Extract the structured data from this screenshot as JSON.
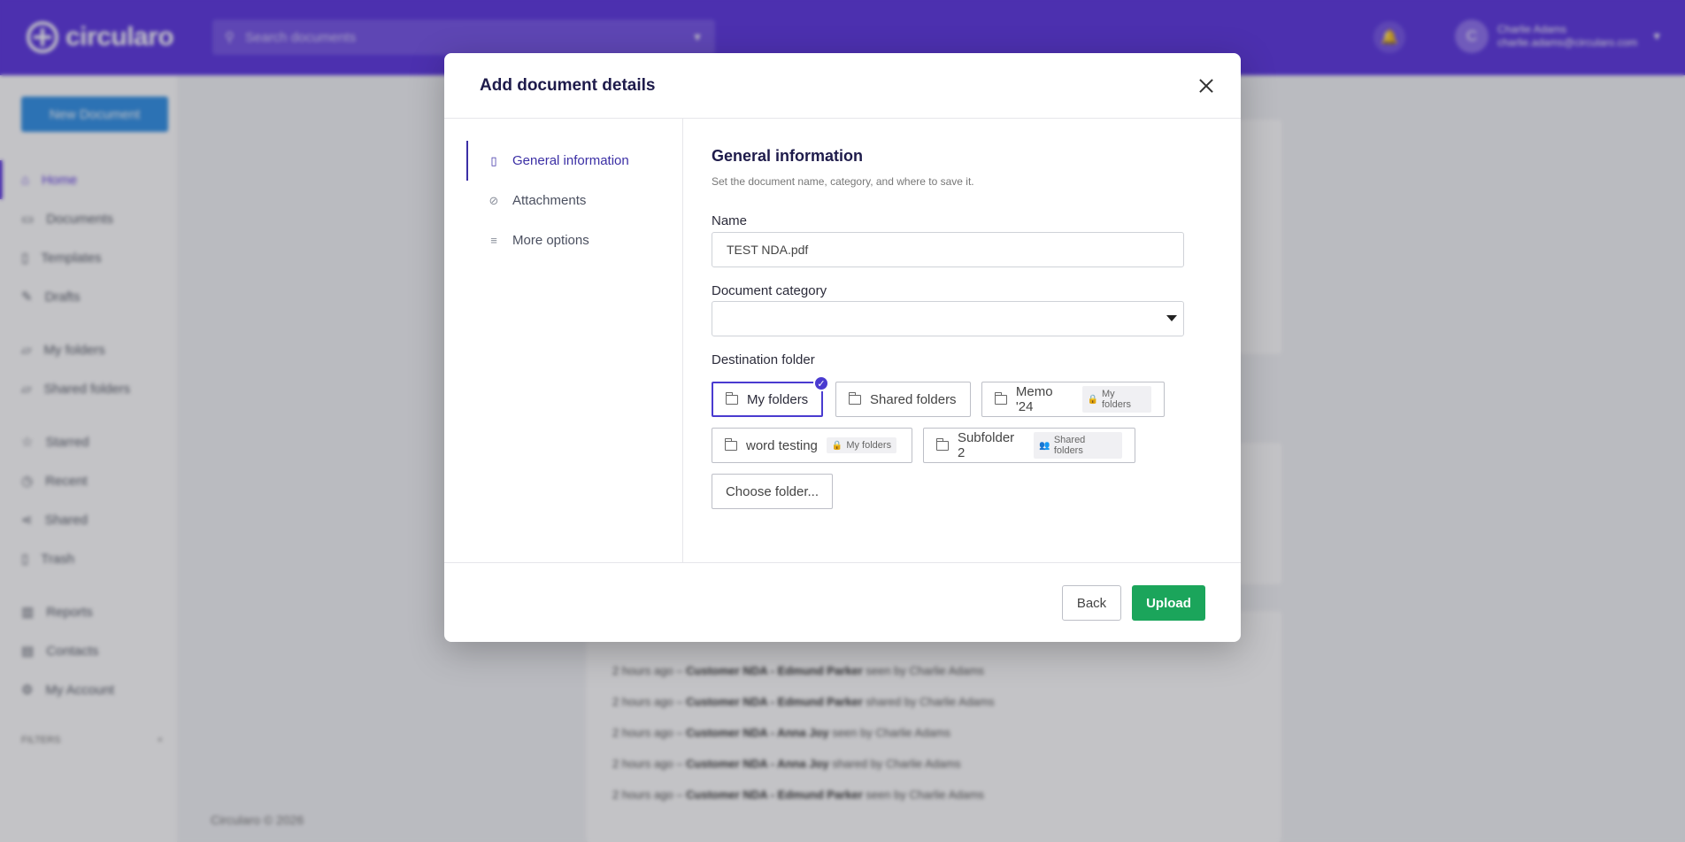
{
  "app": {
    "logo_text": "circularo",
    "search_placeholder": "Search documents",
    "user_name": "Charlie Adams",
    "user_email": "charlie.adams@circularo.com",
    "avatar_initial": "C",
    "new_document_label": "New Document",
    "nav": [
      {
        "label": "Home",
        "icon": "home-icon"
      },
      {
        "label": "Documents",
        "icon": "document-icon"
      },
      {
        "label": "Templates",
        "icon": "template-icon"
      },
      {
        "label": "Drafts",
        "icon": "draft-icon"
      },
      {
        "label": "My folders",
        "icon": "folder-icon"
      },
      {
        "label": "Shared folders",
        "icon": "shared-folder-icon"
      },
      {
        "label": "Starred",
        "icon": "star-icon"
      },
      {
        "label": "Recent",
        "icon": "clock-icon"
      },
      {
        "label": "Shared",
        "icon": "share-icon"
      },
      {
        "label": "Trash",
        "icon": "trash-icon"
      },
      {
        "label": "Reports",
        "icon": "chart-icon"
      },
      {
        "label": "Contacts",
        "icon": "contacts-icon"
      },
      {
        "label": "My Account",
        "icon": "gear-icon"
      }
    ],
    "filters_label": "FILTERS",
    "filters_add": "+",
    "footer": "Circularo © 2026",
    "activity": [
      {
        "time": "2 hours ago",
        "doc": "Customer NDA - Edmund Parker",
        "action": "seen by Charlie Adams"
      },
      {
        "time": "2 hours ago",
        "doc": "Customer NDA - Edmund Parker",
        "action": "shared by Charlie Adams"
      },
      {
        "time": "2 hours ago",
        "doc": "Customer NDA - Anna Joy",
        "action": "seen by Charlie Adams"
      },
      {
        "time": "2 hours ago",
        "doc": "Customer NDA - Anna Joy",
        "action": "shared by Charlie Adams"
      },
      {
        "time": "2 hours ago",
        "doc": "Customer NDA - Edmund Parker",
        "action": "seen by Charlie Adams"
      }
    ]
  },
  "modal": {
    "title": "Add document details",
    "steps": [
      {
        "label": "General information",
        "icon": "file-icon",
        "active": true
      },
      {
        "label": "Attachments",
        "icon": "paperclip-icon",
        "active": false
      },
      {
        "label": "More options",
        "icon": "sliders-icon",
        "active": false
      }
    ],
    "section_title": "General information",
    "section_subtitle": "Set the document name, category, and where to save it.",
    "name_label": "Name",
    "name_value": "TEST NDA.pdf",
    "category_label": "Document category",
    "category_value": "",
    "destination_label": "Destination folder",
    "folders": [
      {
        "label": "My folders",
        "tag": "",
        "selected": true
      },
      {
        "label": "Shared folders",
        "tag": "",
        "selected": false
      },
      {
        "label": "Memo '24",
        "tag": "My folders",
        "tag_icon": "lock-icon",
        "selected": false
      },
      {
        "label": "word testing",
        "tag": "My folders",
        "tag_icon": "lock-icon",
        "selected": false
      },
      {
        "label": "Subfolder 2",
        "tag": "Shared folders",
        "tag_icon": "people-icon",
        "selected": false
      }
    ],
    "choose_folder_label": "Choose folder...",
    "back_label": "Back",
    "upload_label": "Upload",
    "colors": {
      "upload": "#1ba55b",
      "accent": "#4a3bd0",
      "header": "#5a34e0"
    }
  }
}
